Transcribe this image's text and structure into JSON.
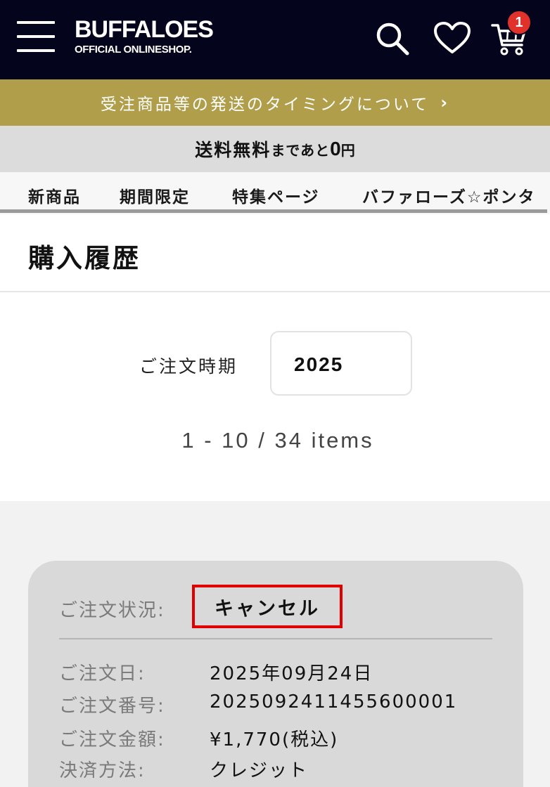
{
  "header": {
    "logo_main": "BUFFALOES",
    "logo_sub": "OFFICIAL ONLINESHOP.",
    "cart_count": "1",
    "icons": [
      "menu-icon",
      "search-icon",
      "heart-icon",
      "cart-icon"
    ]
  },
  "notice": {
    "text": "受注商品等の発送のタイミングについて",
    "chevron": "›"
  },
  "shipping": {
    "part1": "送料無料",
    "part2": "まであと",
    "amount": "0",
    "unit": "円"
  },
  "nav": {
    "items": [
      "新商品",
      "期間限定",
      "特集ページ",
      "バファローズ☆ポンタ"
    ]
  },
  "page": {
    "title": "購入履歴"
  },
  "filter": {
    "label": "ご注文時期",
    "year": "2025",
    "items_count": "1 - 10 / 34 items"
  },
  "order": {
    "status_label": "ご注文状況:",
    "status_value": "キャンセル",
    "rows": [
      {
        "label": "ご注文日:",
        "value": "2025年09月24日"
      },
      {
        "label": "ご注文番号:",
        "value": "20250924114556000​01"
      },
      {
        "label": "ご注文金額:",
        "value": "¥1,770(税込)"
      },
      {
        "label": "決済方法:",
        "value": "クレジット"
      }
    ]
  },
  "colors": {
    "header_bg": "#04041c",
    "notice_bg": "#b09e4a",
    "shipping_bg": "#dcdcdc",
    "badge": "#e0322a",
    "highlight_border": "#e00000",
    "card_bg": "#d9d9d9"
  }
}
